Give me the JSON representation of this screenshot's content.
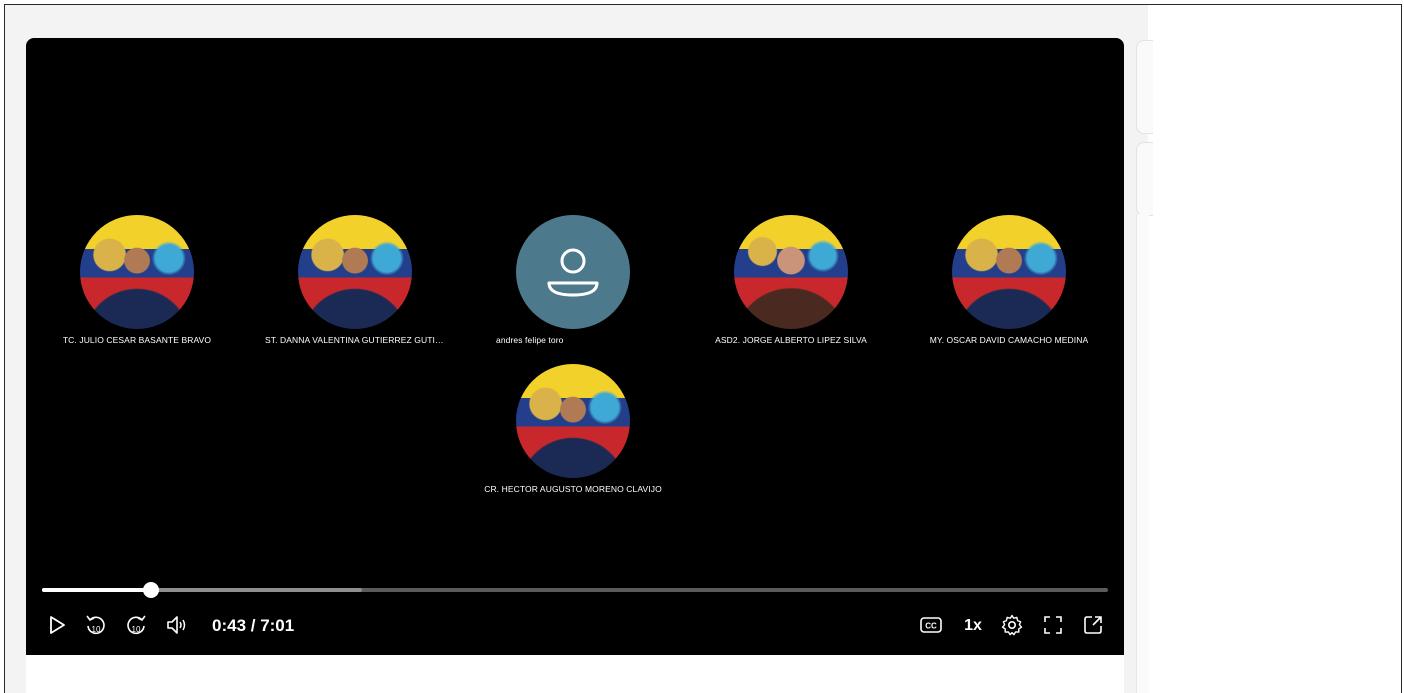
{
  "participants": [
    {
      "name": "TC. JULIO CESAR BASANTE BRAVO",
      "avatar": "photo"
    },
    {
      "name": "ST. DANNA VALENTINA GUTIERREZ GUTIERR...",
      "avatar": "photo"
    },
    {
      "name": "andres felipe toro",
      "avatar": "placeholder"
    },
    {
      "name": "ASD2. JORGE ALBERTO LIPEZ SILVA",
      "avatar": "photo"
    },
    {
      "name": "MY. OSCAR DAVID CAMACHO MEDINA",
      "avatar": "photo"
    },
    {
      "name": "CR. HECTOR AUGUSTO MORENO CLAVIJO",
      "avatar": "photo"
    }
  ],
  "player": {
    "current_time": "0:43",
    "duration": "7:01",
    "time_display": "0:43 / 7:01",
    "played_fraction": 0.102,
    "buffered_fraction": 0.3,
    "speed": "1x"
  },
  "icons": {
    "play": "play-icon",
    "rewind": "rewind-10-icon",
    "forward": "forward-10-icon",
    "volume": "volume-icon",
    "captions": "captions-icon",
    "settings": "gear-icon",
    "fullscreen": "fullscreen-icon",
    "popout": "popout-icon",
    "placeholder_avatar": "person-icon"
  },
  "colors": {
    "player_bg": "#000000",
    "placeholder_avatar": "#4c7a8c",
    "seek_played": "#ffffff",
    "seek_track": "#5b5b5b"
  }
}
